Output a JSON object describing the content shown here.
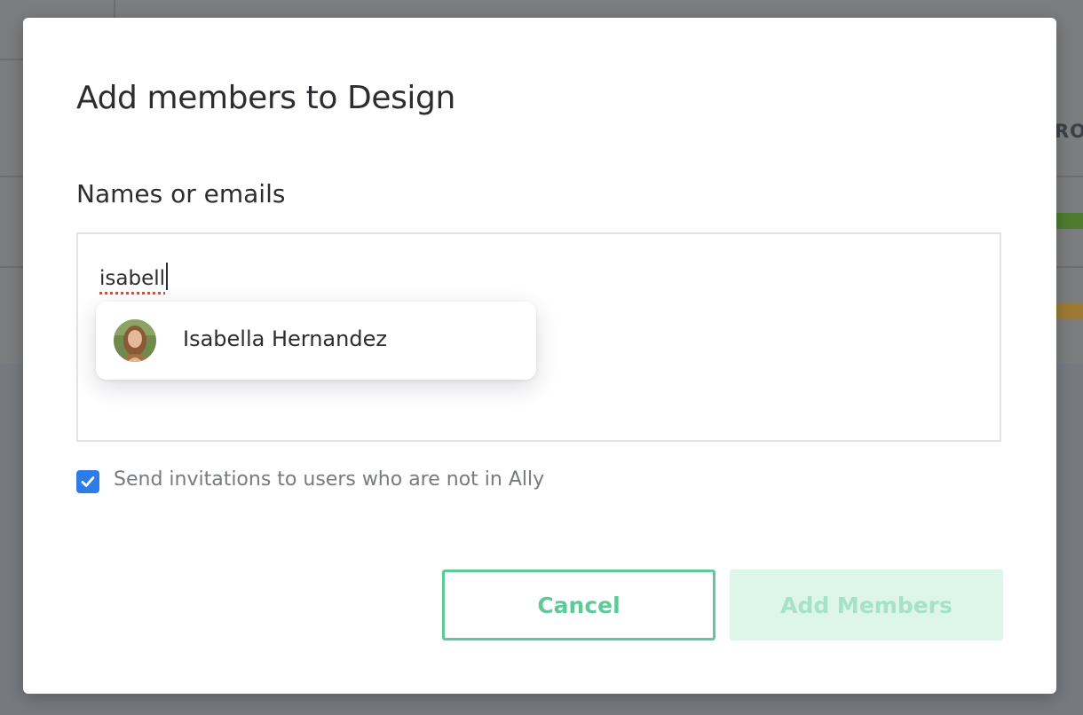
{
  "background": {
    "partial_text": "RO"
  },
  "dialog": {
    "title": "Add members to Design",
    "field_label": "Names or emails",
    "input_value": "isabell",
    "suggestions": [
      {
        "name": "Isabella Hernandez"
      }
    ],
    "send_invites": {
      "label": "Send invitations to users who are not in Ally",
      "checked": true
    },
    "cancel_label": "Cancel",
    "submit_label": "Add Members"
  },
  "colors": {
    "accent": "#5fca98",
    "checkbox": "#2d7ce8",
    "disabled_button_bg": "#def5ea"
  }
}
